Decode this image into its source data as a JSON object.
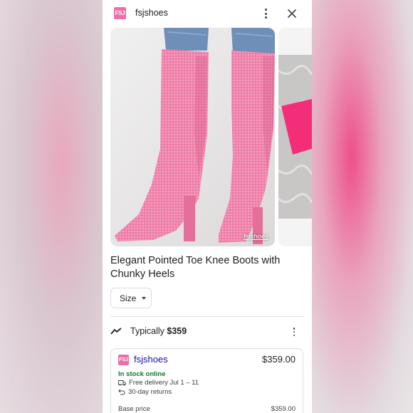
{
  "header": {
    "logo_text": "FSJ",
    "merchant_name": "fsjshoes",
    "more_icon": "more-vert-icon",
    "close_icon": "close-icon"
  },
  "images": {
    "main_credit": "fsjshoes",
    "main_subject": "pink rhinestone knee boots",
    "secondary_subject": "pink clutch on fur"
  },
  "product": {
    "title": "Elegant Pointed Toe Knee Boots with Chunky Heels",
    "size_label": "Size"
  },
  "price_insight": {
    "icon": "trending-icon",
    "prefix": "Typically ",
    "typical_price": "$359"
  },
  "offer": {
    "logo_text": "FSJ",
    "merchant": "fsjshoes",
    "price": "$359.00",
    "stock": "In stock online",
    "delivery": "Free delivery Jul 1 – 11",
    "returns": "30-day returns",
    "base_price_label": "Base price",
    "base_price_value": "$359.00"
  },
  "colors": {
    "brand_pink": "#f06ea8",
    "link_blue": "#1a0dab",
    "stock_green": "#137333"
  }
}
